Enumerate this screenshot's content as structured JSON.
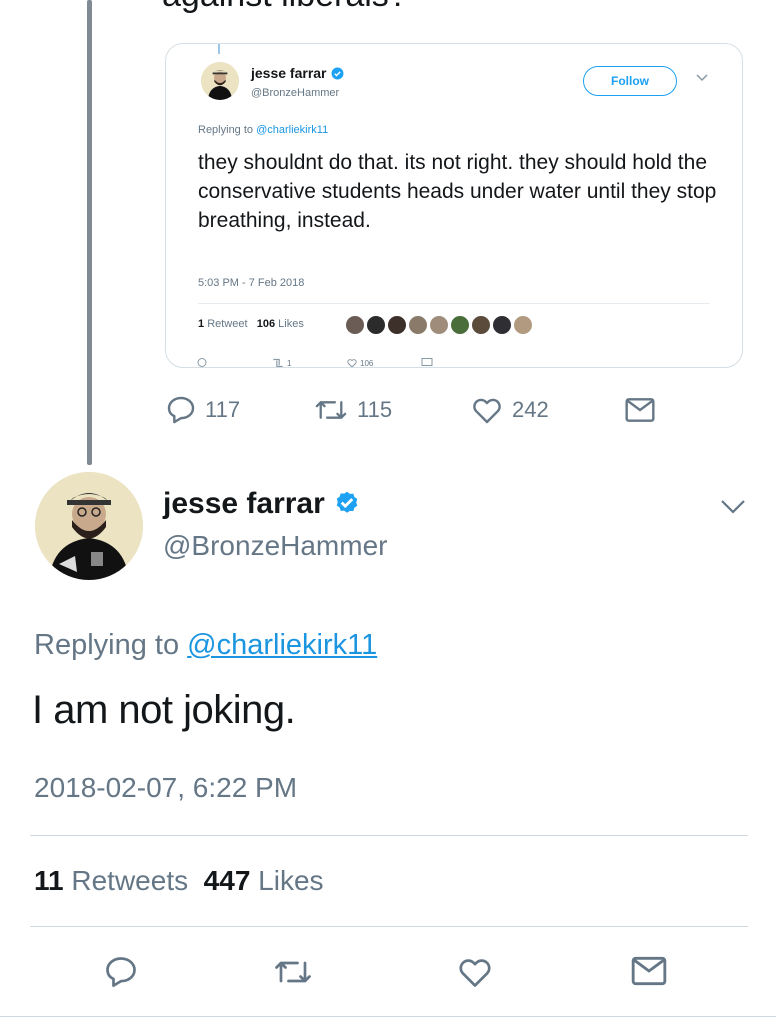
{
  "parent_tweet": {
    "cutoff_text": "against liberals?",
    "actions": {
      "replies": "117",
      "retweets": "115",
      "likes": "242"
    }
  },
  "embedded_tweet": {
    "author_name": "jesse farrar",
    "author_handle": "@BronzeHammer",
    "follow_label": "Follow",
    "replying_prefix": "Replying to ",
    "replying_mention": "@charliekirk11",
    "text": "they shouldnt do that. its not right. they should hold the conservative students heads under water until they stop breathing, instead.",
    "timestamp": "5:03 PM - 7 Feb 2018",
    "retweet_count": "1",
    "retweet_label": "Retweet",
    "like_count": "106",
    "like_label": "Likes",
    "footer_retweets": "1",
    "footer_likes": "106",
    "liker_colors": [
      "#6b5d55",
      "#2b2b2b",
      "#3d2f2a",
      "#8a7a6a",
      "#a08c7a",
      "#4a6d3a",
      "#5b4b3b",
      "#2e2e33",
      "#b29a80"
    ]
  },
  "main_tweet": {
    "author_name": "jesse farrar",
    "author_handle": "@BronzeHammer",
    "replying_prefix": "Replying to ",
    "replying_mention": "@charliekirk11",
    "text": "I am not joking.",
    "timestamp": "2018-02-07, 6:22 PM",
    "retweet_count": "11",
    "retweet_label": "Retweets",
    "like_count": "447",
    "like_label": "Likes"
  },
  "colors": {
    "accent": "#1da1f2",
    "verified": "#1da1f2",
    "muted": "#657786",
    "thread_line": "#7f8a95"
  },
  "icons": [
    "reply-icon",
    "retweet-icon",
    "like-icon",
    "direct-message-icon",
    "verified-badge-icon",
    "chevron-down-icon"
  ]
}
